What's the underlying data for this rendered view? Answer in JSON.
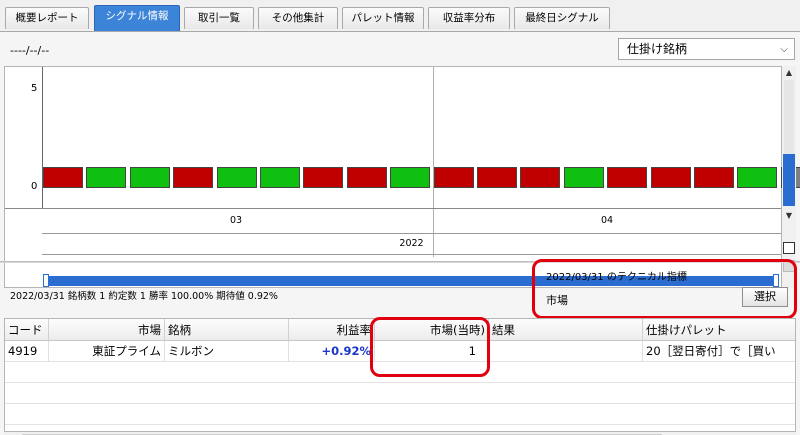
{
  "tabs": [
    {
      "label": "概要レポート",
      "active": false
    },
    {
      "label": "シグナル情報",
      "active": true
    },
    {
      "label": "取引一覧",
      "active": false
    },
    {
      "label": "その他集計",
      "active": false
    },
    {
      "label": "パレット情報",
      "active": false
    },
    {
      "label": "収益率分布",
      "active": false
    },
    {
      "label": "最終日シグナル",
      "active": false
    }
  ],
  "header": {
    "date": "----/--/--",
    "dropdown_value": "仕掛け銘柄",
    "dropdown_arrow": "⌵"
  },
  "chart_data": {
    "type": "bar",
    "y_ticks": [
      "5",
      "0"
    ],
    "x_groups": [
      "03",
      "04"
    ],
    "year": "2022",
    "bar_colors": [
      "#c00000",
      "#10c010",
      "#10c010",
      "#c00000",
      "#10c010",
      "#10c010",
      "#c00000",
      "#c00000",
      "#10c010",
      "#c00000",
      "#c00000",
      "#c00000",
      "#10c010",
      "#c00000",
      "#c00000",
      "#c00000",
      "#10c010",
      "#808080"
    ],
    "colors": {
      "red": "#c00000",
      "green": "#10c010",
      "gray": "#808080"
    }
  },
  "summary": {
    "text": "2022/03/31 銘柄数 1 約定数 1 勝率 100.00% 期待値 0.92%"
  },
  "tech": {
    "title": "2022/03/31 のテクニカル指標",
    "label": "市場",
    "button": "選択"
  },
  "table": {
    "headers": [
      "コード",
      "市場",
      "銘柄",
      "利益率",
      "市場(当時)",
      "結果",
      "仕掛けパレット"
    ],
    "rows": [
      [
        "4919",
        "東証プライム",
        "ミルボン",
        "+0.92%",
        "1",
        "",
        "20［翌日寄付］で［買い"
      ]
    ]
  },
  "colors": {
    "accent": "#3c84d8",
    "highlight": "#e00010",
    "positive": "#1a36c8"
  }
}
